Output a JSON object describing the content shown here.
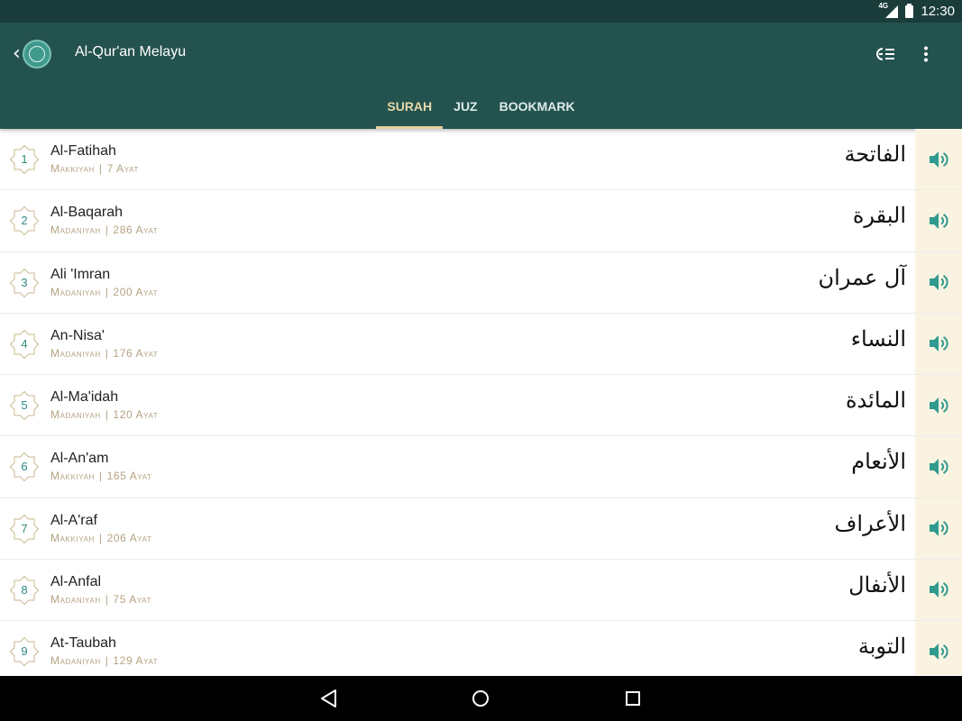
{
  "status_bar": {
    "network": "4G",
    "time": "12:30"
  },
  "app_bar": {
    "title": "Al-Qur'an Melayu"
  },
  "tabs": [
    {
      "label": "SURAH",
      "active": true
    },
    {
      "label": "JUZ",
      "active": false
    },
    {
      "label": "BOOKMARK",
      "active": false
    }
  ],
  "colors": {
    "app_bar": "#24524f",
    "status_bar": "#1a3d3b",
    "accent_teal": "#2f8a80",
    "tab_indicator": "#e0cfa0",
    "meta_text": "#b5a383",
    "play_column": "#faf3e1"
  },
  "surahs": [
    {
      "number": "1",
      "name": "Al-Fatihah",
      "type": "Makkiyah",
      "verses": "7 Ayat",
      "arabic": "الفاتحة"
    },
    {
      "number": "2",
      "name": "Al-Baqarah",
      "type": "Madaniyah",
      "verses": "286 Ayat",
      "arabic": "البقرة"
    },
    {
      "number": "3",
      "name": "Ali 'Imran",
      "type": "Madaniyah",
      "verses": "200 Ayat",
      "arabic": "آل عمران"
    },
    {
      "number": "4",
      "name": "An-Nisa'",
      "type": "Madaniyah",
      "verses": "176 Ayat",
      "arabic": "النساء"
    },
    {
      "number": "5",
      "name": "Al-Ma'idah",
      "type": "Madaniyah",
      "verses": "120 Ayat",
      "arabic": "المائدة"
    },
    {
      "number": "6",
      "name": "Al-An'am",
      "type": "Makkiyah",
      "verses": "165 Ayat",
      "arabic": "الأنعام"
    },
    {
      "number": "7",
      "name": "Al-A'raf",
      "type": "Makkiyah",
      "verses": "206 Ayat",
      "arabic": "الأعراف"
    },
    {
      "number": "8",
      "name": "Al-Anfal",
      "type": "Madaniyah",
      "verses": "75 Ayat",
      "arabic": "الأنفال"
    },
    {
      "number": "9",
      "name": "At-Taubah",
      "type": "Madaniyah",
      "verses": "129 Ayat",
      "arabic": "التوبة"
    }
  ]
}
